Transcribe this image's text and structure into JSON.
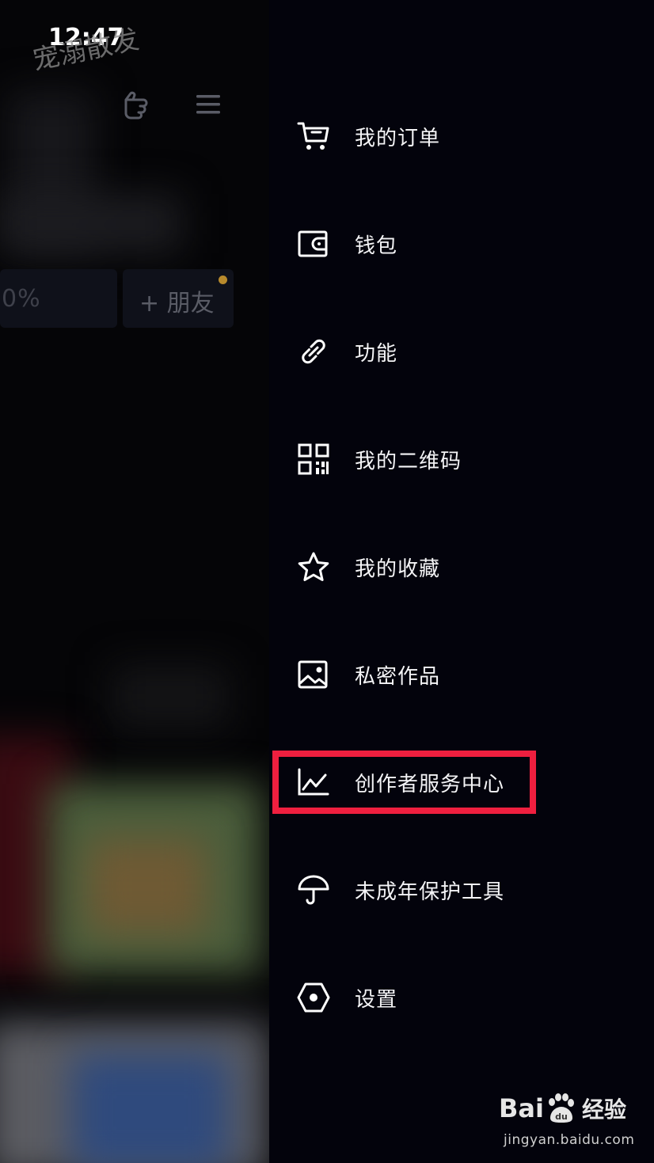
{
  "status_bar": {
    "time": "12:47",
    "watermark": "宠溺散发"
  },
  "background": {
    "percent_text": "0%",
    "add_friend_label": "+ 朋友"
  },
  "drawer": {
    "items": [
      {
        "label": "我的订单",
        "icon": "cart-icon"
      },
      {
        "label": "钱包",
        "icon": "wallet-icon"
      },
      {
        "label": "功能",
        "icon": "link-icon"
      },
      {
        "label": "我的二维码",
        "icon": "qr-code-icon"
      },
      {
        "label": "我的收藏",
        "icon": "star-icon"
      },
      {
        "label": "私密作品",
        "icon": "image-icon"
      },
      {
        "label": "创作者服务中心",
        "icon": "chart-icon",
        "highlighted": true
      },
      {
        "label": "未成年保护工具",
        "icon": "umbrella-icon"
      },
      {
        "label": "设置",
        "icon": "hexagon-settings-icon"
      }
    ],
    "highlight_color": "#ef1f3f"
  },
  "watermark": {
    "brand": "Bai",
    "brand_suffix": "经验",
    "url": "jingyan.baidu.com"
  }
}
